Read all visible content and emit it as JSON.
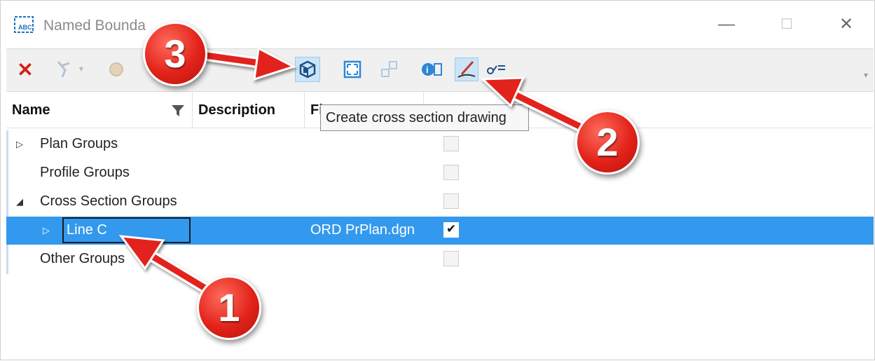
{
  "window": {
    "title": "Named Bounda",
    "minimize_glyph": "—",
    "maximize_glyph": "☐",
    "close_glyph": "✕"
  },
  "toolbar": {
    "buttons": [
      {
        "icon": "delete-icon"
      },
      {
        "icon": "select-boundary-icon",
        "state": "disabled"
      },
      {
        "icon": "group-icon",
        "state": "disabled"
      },
      {
        "icon": "create-cross-section-icon",
        "state": "active"
      },
      {
        "icon": "zoom-extents-icon"
      },
      {
        "icon": "move-icon",
        "state": "disabled"
      },
      {
        "icon": "properties-icon"
      },
      {
        "icon": "edit-pen-icon",
        "state": "active"
      },
      {
        "icon": "key-options-icon"
      }
    ],
    "tooltip": "Create cross section drawing"
  },
  "columns": {
    "name": "Name",
    "description": "Description",
    "file": "Fi"
  },
  "rows": [
    {
      "label": "Plan Groups",
      "expander": "▷",
      "file": "",
      "checked": false
    },
    {
      "label": "Profile Groups",
      "expander": "",
      "file": "",
      "checked": false
    },
    {
      "label": "Cross Section Groups",
      "expander": "◢",
      "file": "",
      "checked": false
    },
    {
      "label": "Line C",
      "expander": "▷",
      "file": "ORD PrPlan.dgn",
      "checked": true,
      "selected": true
    },
    {
      "label": "Other Groups",
      "expander": "",
      "file": "",
      "checked": false
    }
  ],
  "callouts": [
    "1",
    "2",
    "3"
  ],
  "colors": {
    "selection": "#3399ee",
    "callout": "#e2231a",
    "toolbar_bg": "#f0f0f0"
  }
}
